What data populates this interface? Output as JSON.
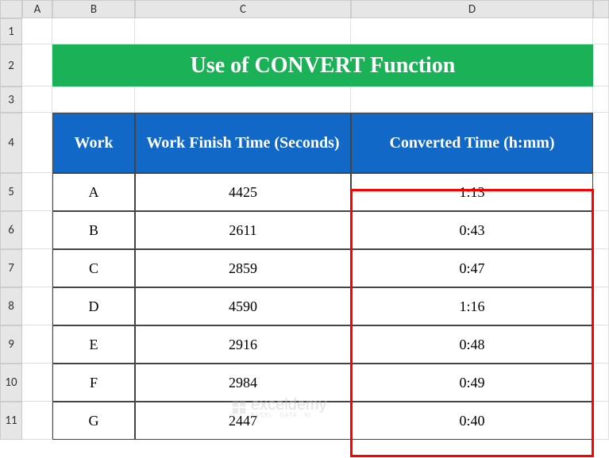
{
  "columns": [
    "A",
    "B",
    "C",
    "D"
  ],
  "rows": [
    "1",
    "2",
    "3",
    "4",
    "5",
    "6",
    "7",
    "8",
    "9",
    "10",
    "11"
  ],
  "title": "Use of CONVERT Function",
  "table": {
    "headers": {
      "work": "Work",
      "seconds": "Work Finish Time (Seconds)",
      "converted": "Converted Time (h:mm)"
    },
    "rows": [
      {
        "work": "A",
        "seconds": "4425",
        "converted": "1:13"
      },
      {
        "work": "B",
        "seconds": "2611",
        "converted": "0:43"
      },
      {
        "work": "C",
        "seconds": "2859",
        "converted": "0:47"
      },
      {
        "work": "D",
        "seconds": "4590",
        "converted": "1:16"
      },
      {
        "work": "E",
        "seconds": "2916",
        "converted": "0:48"
      },
      {
        "work": "F",
        "seconds": "2984",
        "converted": "0:49"
      },
      {
        "work": "G",
        "seconds": "2447",
        "converted": "0:40"
      }
    ]
  },
  "watermark": {
    "brand": "exceldemy",
    "tagline": "EXCEL · DATA · BI"
  },
  "chart_data": {
    "type": "table",
    "title": "Use of CONVERT Function",
    "columns": [
      "Work",
      "Work Finish Time (Seconds)",
      "Converted Time (h:mm)"
    ],
    "rows": [
      [
        "A",
        4425,
        "1:13"
      ],
      [
        "B",
        2611,
        "0:43"
      ],
      [
        "C",
        2859,
        "0:47"
      ],
      [
        "D",
        4590,
        "1:16"
      ],
      [
        "E",
        2916,
        "0:48"
      ],
      [
        "F",
        2984,
        "0:49"
      ],
      [
        "G",
        2447,
        "0:40"
      ]
    ]
  }
}
